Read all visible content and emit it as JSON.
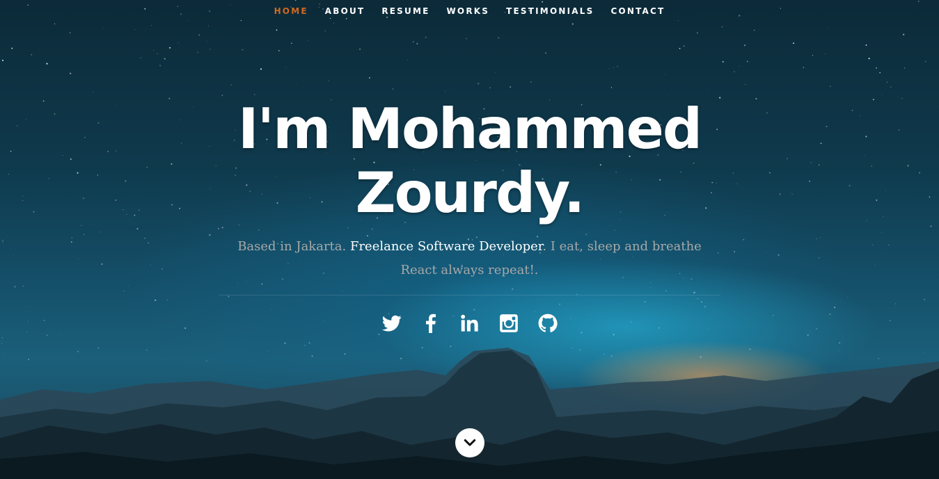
{
  "nav": {
    "items": [
      {
        "label": "HOME",
        "active": true
      },
      {
        "label": "ABOUT",
        "active": false
      },
      {
        "label": "RESUME",
        "active": false
      },
      {
        "label": "WORKS",
        "active": false
      },
      {
        "label": "TESTIMONIALS",
        "active": false
      },
      {
        "label": "CONTACT",
        "active": false
      }
    ],
    "active_color": "#d2691e"
  },
  "banner": {
    "headline": "I'm Mohammed Zourdy.",
    "tagline_prefix": "Based in Jakarta. ",
    "tagline_strong": "Freelance Software Developer",
    "tagline_suffix": ". I eat, sleep and breathe React always repeat!."
  },
  "social": [
    {
      "icon": "twitter-icon"
    },
    {
      "icon": "facebook-icon"
    },
    {
      "icon": "linkedin-icon"
    },
    {
      "icon": "instagram-icon"
    },
    {
      "icon": "github-icon"
    }
  ],
  "scroll_down": {
    "icon": "chevron-down-icon"
  }
}
